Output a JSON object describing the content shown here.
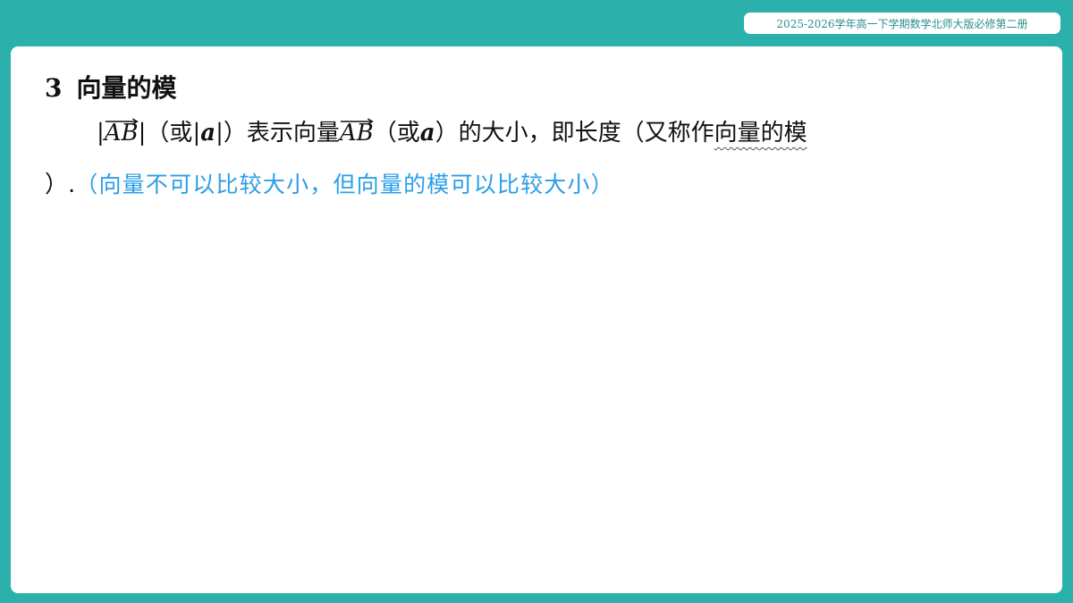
{
  "header": {
    "course_tag": "2025-2026学年高一下学期数学北师大版必修第二册"
  },
  "section": {
    "number": "3",
    "title": "向量的模"
  },
  "content": {
    "vector_label": "AB",
    "paren_open": "（或",
    "vector_a": "a",
    "paren_close": "）",
    "text_represents": "表示向量",
    "text_paren_open2": "（或",
    "text_after_a": "）的大小，即长度（又称作",
    "term_modulus": "向量的模",
    "line2_start": "）.",
    "note": "（向量不可以比较大小，但向量的模可以比较大小）"
  },
  "colors": {
    "frame": "#2bb0ab",
    "note_text": "#2a9ee8"
  }
}
